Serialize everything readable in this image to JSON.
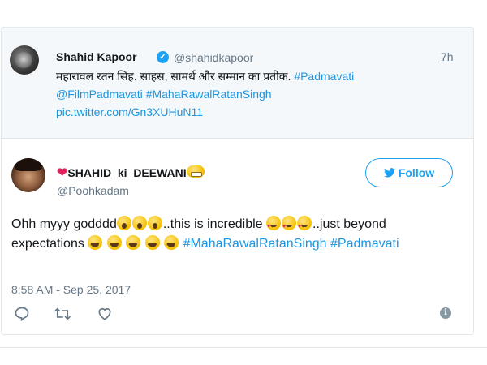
{
  "quoted_tweet": {
    "author_name": "Shahid Kapoor",
    "handle": "@shahidkapoor",
    "time": "7h",
    "text_hindi": "महारावल रतन सिंह. साहस, सामर्थ और सम्मान का प्रतीक.",
    "hashtag_1": "#Padmavati",
    "mention": "@FilmPadmavati",
    "hashtag_2": "#MahaRawalRatanSingh",
    "pic_link": "pic.twitter.com/Gn3XUHuN11"
  },
  "tweet": {
    "author_name": "SHAHID_ki_DEEWANI",
    "handle": "@Poohkadam",
    "follow_label": "Follow",
    "text_part1": "Ohh myyy godddd",
    "text_part2": "..this is incredible",
    "text_part3": "..just beyond expectations",
    "hashtag_1": "#MahaRawalRatanSingh",
    "hashtag_2": "#Padmavati",
    "date": "8:58 AM - Sep 25, 2017"
  },
  "icons": {
    "verified": "verified-badge-icon",
    "reply": "reply-icon",
    "retweet": "retweet-icon",
    "like": "heart-icon",
    "info": "info-icon",
    "follow_bird": "twitter-bird-icon"
  },
  "colors": {
    "accent": "#1da1f2",
    "link": "#1b95e0",
    "muted": "#657786",
    "quoted_bg": "#f5f8fa",
    "heart": "#e0245e"
  }
}
